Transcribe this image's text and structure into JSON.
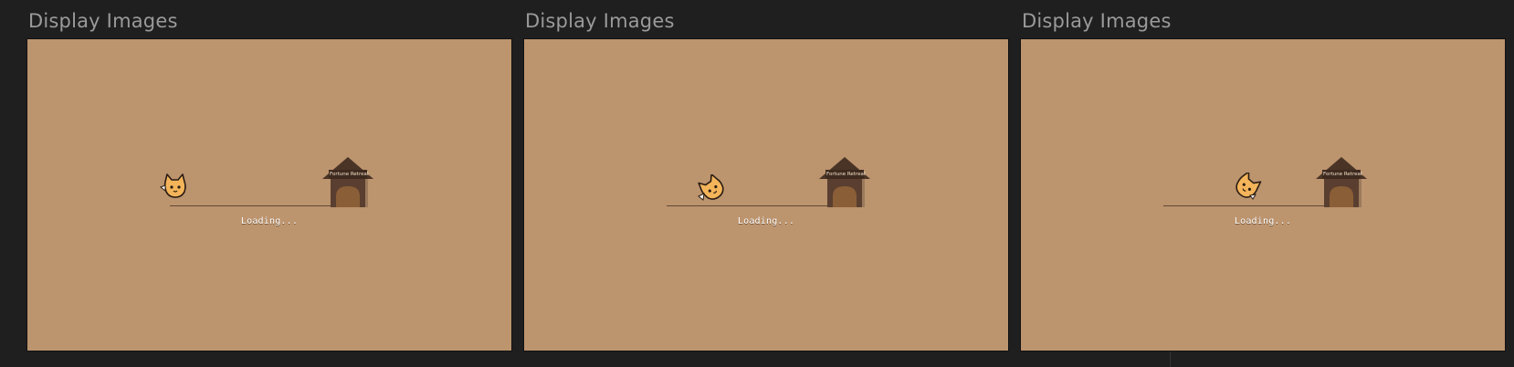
{
  "panels": [
    {
      "title": "Display Images",
      "sign": "Fortune Retreat",
      "loading": "Loading...",
      "cat_pose": "walking"
    },
    {
      "title": "Display Images",
      "sign": "Fortune Retreat",
      "loading": "Loading...",
      "cat_pose": "tumbling"
    },
    {
      "title": "Display Images",
      "sign": "Fortune Retreat",
      "loading": "Loading...",
      "cat_pose": "rolling"
    }
  ],
  "colors": {
    "background": "#1f1f1f",
    "canvas": "#bc946e",
    "house_roof": "#4a3426",
    "house_body": "#5a3f30",
    "cat": "#f4b45a"
  },
  "icons": [
    "cat-icon",
    "dog-house-icon"
  ]
}
